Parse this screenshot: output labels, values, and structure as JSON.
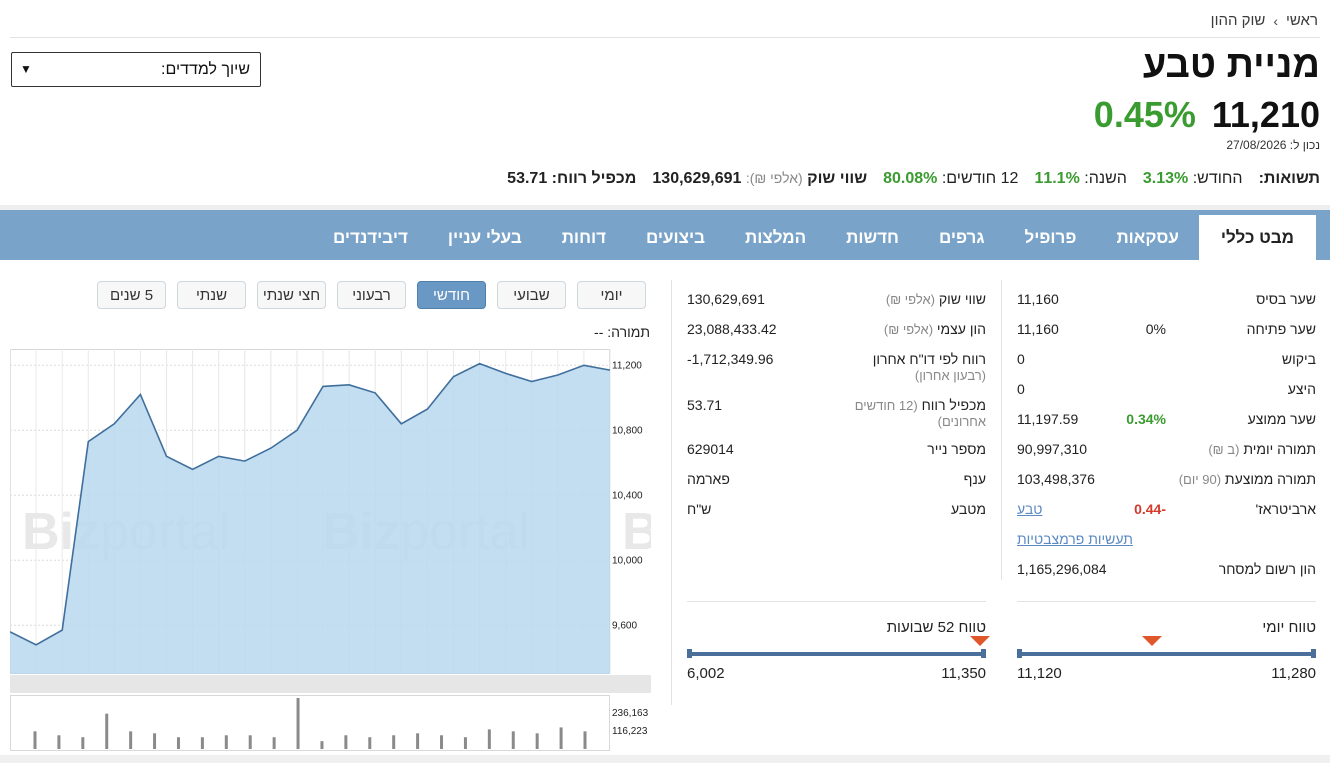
{
  "breadcrumb": {
    "home": "ראשי",
    "current": "שוק ההון"
  },
  "index_select": {
    "label": "שיוך למדדים:"
  },
  "stock": {
    "name": "מניית טבע",
    "price": "11,210",
    "change_pct": "0.45%",
    "as_of": "נכון ל: 27/08/2026"
  },
  "returns": {
    "title": "תשואות:",
    "month_label": "החודש:",
    "month_value": "3.13%",
    "year_label": "השנה:",
    "year_value": "11.1%",
    "twelve_label": "12 חודשים:",
    "twelve_value": "80.08%",
    "mcap_label": "שווי שוק",
    "mcap_unit": "(אלפי ₪):",
    "mcap_value": "130,629,691",
    "pe_label": "מכפיל רווח:",
    "pe_value": "53.71"
  },
  "tabs": [
    "מבט כללי",
    "עסקאות",
    "פרופיל",
    "גרפים",
    "חדשות",
    "המלצות",
    "ביצועים",
    "דוחות",
    "בעלי עניין",
    "דיבידנדים"
  ],
  "trading": {
    "base_label": "שער בסיס",
    "base": "11,160",
    "open_label": "שער פתיחה",
    "open": "11,160",
    "open_pct": "0%",
    "bid_label": "ביקוש",
    "bid": "0",
    "ask_label": "היצע",
    "ask": "0",
    "avg_label": "שער ממוצע",
    "avg": "11,197.59",
    "avg_pct": "0.34%",
    "daily_vol_label": "תמורה יומית",
    "daily_vol_unit": "(ב ₪)",
    "daily_vol": "90,997,310",
    "avg_vol_label": "תמורה ממוצעת",
    "avg_vol_unit": "(90 יום)",
    "avg_vol": "103,498,376",
    "arb_label": "ארביטראז'",
    "arb_value": "-0.44",
    "arb_link": "טבע",
    "structured_link": "תעשיות פרמצבטיות",
    "registered_label": "הון רשום למסחר",
    "registered": "1,165,296,084"
  },
  "fundamentals": {
    "mcap_label": "שווי שוק",
    "mcap_unit": "(אלפי ₪)",
    "mcap": "130,629,691",
    "equity_label": "הון עצמי",
    "equity_unit": "(אלפי ₪)",
    "equity": "23,088,433.42",
    "profit_label": "רווח לפי דו\"ח אחרון",
    "profit_unit": "(רבעון אחרון)",
    "profit": "-1,712,349.96",
    "pe_label": "מכפיל רווח",
    "pe_unit": "(12 חודשים אחרונים)",
    "pe": "53.71",
    "security_label": "מספר נייר",
    "security": "629014",
    "sector_label": "ענף",
    "sector": "פארמה",
    "currency_label": "מטבע",
    "currency": "ש\"ח"
  },
  "ranges": {
    "daily_title": "טווח יומי",
    "daily_low": "11,120",
    "daily_high": "11,280",
    "daily_position": 0.45,
    "week52_title": "טווח 52 שבועות",
    "week52_low": "6,002",
    "week52_high": "11,350",
    "week52_position": 0.02
  },
  "periods": [
    "יומי",
    "שבועי",
    "חודשי",
    "רבעוני",
    "חצי שנתי",
    "שנתי",
    "5 שנים"
  ],
  "active_period": "חודשי",
  "volume_label": "תמורה: --",
  "colors": {
    "accent": "#7aa3c9",
    "positive": "#3a9b30",
    "negative": "#d23b2b"
  },
  "chart_data": {
    "type": "area",
    "y_ticks": [
      "11,200",
      "10,800",
      "10,400",
      "10,000",
      "9,600"
    ],
    "ylim": [
      9300,
      11300
    ],
    "values": [
      9560,
      9480,
      9570,
      10730,
      10840,
      11020,
      10640,
      10560,
      10640,
      10610,
      10690,
      10800,
      11070,
      11080,
      11030,
      10840,
      10930,
      11130,
      11210,
      11150,
      11100,
      11140,
      11200,
      11170
    ],
    "volume_ticks": [
      "236,163",
      "116,223"
    ],
    "volumes": [
      90,
      70,
      60,
      180,
      90,
      80,
      60,
      60,
      70,
      70,
      60,
      260,
      40,
      70,
      60,
      70,
      80,
      70,
      60,
      100,
      90,
      80,
      110,
      90
    ]
  }
}
